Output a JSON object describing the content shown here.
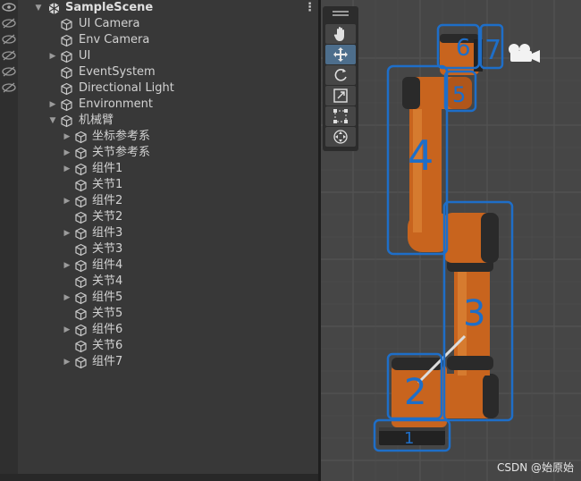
{
  "hierarchy": {
    "scene_name": "SampleScene",
    "items": [
      {
        "label": "UI Camera"
      },
      {
        "label": "Env Camera"
      },
      {
        "label": "UI"
      },
      {
        "label": "EventSystem"
      },
      {
        "label": "Directional Light"
      },
      {
        "label": "Environment"
      },
      {
        "label": "机械臂"
      },
      {
        "label": "坐标参考系"
      },
      {
        "label": "关节参考系"
      },
      {
        "label": "组件1"
      },
      {
        "label": "关节1"
      },
      {
        "label": "组件2"
      },
      {
        "label": "关节2"
      },
      {
        "label": "组件3"
      },
      {
        "label": "关节3"
      },
      {
        "label": "组件4"
      },
      {
        "label": "关节4"
      },
      {
        "label": "组件5"
      },
      {
        "label": "关节5"
      },
      {
        "label": "组件6"
      },
      {
        "label": "关节6"
      },
      {
        "label": "组件7"
      }
    ]
  },
  "scene_view": {
    "tools": [
      "view-tool",
      "move-tool",
      "rotate-tool",
      "scale-tool",
      "rect-tool",
      "transform-tool"
    ],
    "active_tool": "move-tool",
    "annotations": [
      "1",
      "2",
      "3",
      "4",
      "5",
      "6",
      "7"
    ],
    "annotation_color": "#1e6ec8",
    "robot_color": "#c8641e"
  },
  "watermark": "CSDN @始原始"
}
